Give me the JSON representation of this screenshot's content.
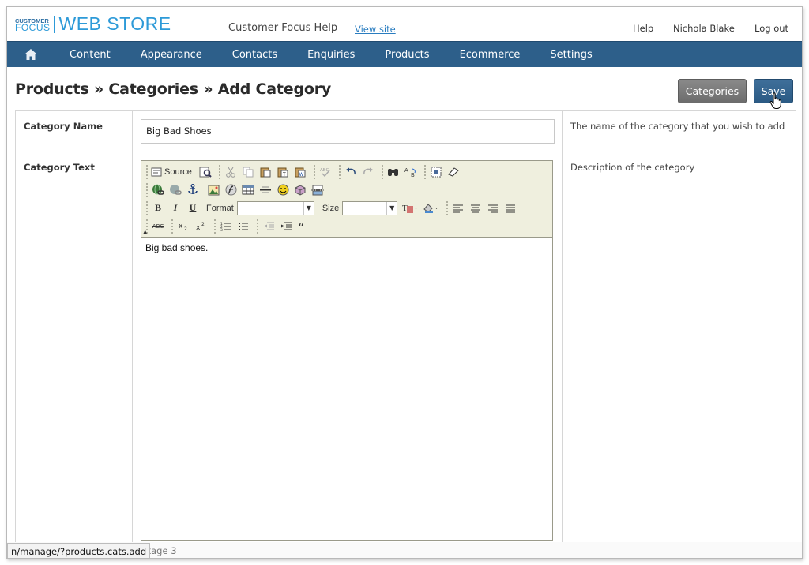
{
  "brand": {
    "small_line1": "CUSTOMER",
    "small_line2": "FOCUS",
    "big": "WEB STORE"
  },
  "header": {
    "help_title": "Customer Focus Help",
    "view_site": "View site",
    "links": [
      "Help",
      "Nichola Blake",
      "Log out"
    ]
  },
  "nav": {
    "home_icon": "home-icon",
    "items": [
      "Content",
      "Appearance",
      "Contacts",
      "Enquiries",
      "Products",
      "Ecommerce",
      "Settings"
    ]
  },
  "page": {
    "title": "Products » Categories » Add Category",
    "btn_categories": "Categories",
    "btn_save": "Save"
  },
  "form": {
    "name": {
      "label": "Category Name",
      "value": "Big Bad Shoes",
      "help": "The name of the category that you wish to add"
    },
    "text": {
      "label": "Category Text",
      "help": "Description of the category",
      "content": "Big bad shoes."
    }
  },
  "editor": {
    "source_label": "Source",
    "format_label": "Format",
    "size_label": "Size",
    "bold": "B",
    "italic": "I",
    "underline": "U",
    "strike": "ABC",
    "collapse": "▲"
  },
  "status": {
    "url": "n/manage/?products.cats.add",
    "package": "package 3"
  }
}
